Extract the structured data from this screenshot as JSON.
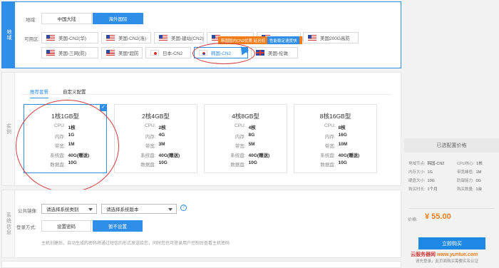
{
  "region_section": {
    "side_label": "地域",
    "area_label": "地域:",
    "area_tabs": [
      "中国大陆",
      "海外国际"
    ],
    "active_area_tab": 1,
    "zone_label": "可用区:",
    "zones_row1": [
      {
        "name": "美国-CN2(华)",
        "flag": "us"
      },
      {
        "name": "美国-CN2(洛)",
        "flag": "us"
      },
      {
        "name": "美国-建站(CN2)",
        "flag": "us"
      },
      {
        "name": "美国-CN2",
        "flag": "us"
      },
      {
        "name": "美国-CN2特惠",
        "flag": "us"
      },
      {
        "name": "美国200G高防",
        "flag": "us"
      }
    ],
    "zones_row2": [
      {
        "name": "美国-三网(防)",
        "flag": "us"
      },
      {
        "name": "美国*超防",
        "flag": "us"
      },
      {
        "name": "日本-CN2",
        "flag": "jp"
      },
      {
        "name": "韩国-CN2",
        "flag": "kr"
      },
      {
        "name": "美国-伦敦",
        "flag": "uk"
      }
    ],
    "selected_zone": "韩国-CN2",
    "tooltip_text": "韩国国内CN2优质 延迟低",
    "tooltip_badge": "性能稳定速度快"
  },
  "spec_section": {
    "side_label": "实例",
    "subtabs": [
      "推荐套餐",
      "自定义配置"
    ],
    "active_subtab": 0,
    "cards": [
      {
        "title": "1核1GB型",
        "rows": [
          [
            "CPU:",
            "1核"
          ],
          [
            "内存:",
            "1G"
          ],
          [
            "带宽:",
            "1M"
          ],
          [
            "系统盘:",
            "40G(赠送)"
          ],
          [
            "数据盘:",
            "10G"
          ]
        ],
        "selected": true
      },
      {
        "title": "2核4GB型",
        "rows": [
          [
            "CPU:",
            "2核"
          ],
          [
            "内存:",
            "4G"
          ],
          [
            "带宽:",
            "3M"
          ],
          [
            "系统盘:",
            "40G(赠送)"
          ],
          [
            "数据盘:",
            "10G"
          ]
        ],
        "selected": false
      },
      {
        "title": "4核8GB型",
        "rows": [
          [
            "CPU:",
            "4核"
          ],
          [
            "内存:",
            "8G"
          ],
          [
            "带宽:",
            "5M"
          ],
          [
            "系统盘:",
            "40G(赠送)"
          ],
          [
            "数据盘:",
            "10G"
          ]
        ],
        "selected": false
      },
      {
        "title": "8核16GB型",
        "rows": [
          [
            "CPU:",
            "8核"
          ],
          [
            "内存:",
            "16G"
          ],
          [
            "带宽:",
            "10M"
          ],
          [
            "系统盘:",
            "40G(赠送)"
          ],
          [
            "数据盘:",
            "10G"
          ]
        ],
        "selected": false
      }
    ],
    "check_mark": "✓"
  },
  "system_section": {
    "side_label": "系统信息",
    "image_label": "公共镜像:",
    "os_type_placeholder": "请选择系统类别",
    "os_version_placeholder": "请选择系统版本",
    "help": "?",
    "login_label": "登录方式:",
    "login_options": [
      "设置密码",
      "暂不设置"
    ],
    "active_login_option": 1,
    "note": "主机创建后，自动生成的密码将通过短信的形式发送给您，同时您也可登录用户控制台查看主机密码"
  },
  "price_panel": {
    "header": "已选配置价格",
    "rows": [
      [
        [
          "地域节点:",
          "韩国-CN2"
        ],
        [
          "CPU核心:",
          "1核"
        ]
      ],
      [
        [
          "内存大小:",
          "1G"
        ],
        [
          "带宽峰值:",
          "1M"
        ]
      ],
      [
        [
          "硬盘大小:",
          "10G"
        ],
        [
          "防御能力:",
          "0G"
        ]
      ],
      [
        [
          "购买时长:",
          "1个月"
        ],
        [
          "购买数量:",
          "1台"
        ]
      ]
    ],
    "price_label": "价格:",
    "price": "¥ 55.00",
    "buy_button": "立即购买",
    "login_tip": "请先登录，此页面购买需要实名认证",
    "watermark_cn": "云服务器网",
    "watermark_url": "www.yuntue.com"
  },
  "colors": {
    "accent": "#2f8ee8",
    "price": "#f07d1a",
    "annotation": "#d23c3c"
  }
}
